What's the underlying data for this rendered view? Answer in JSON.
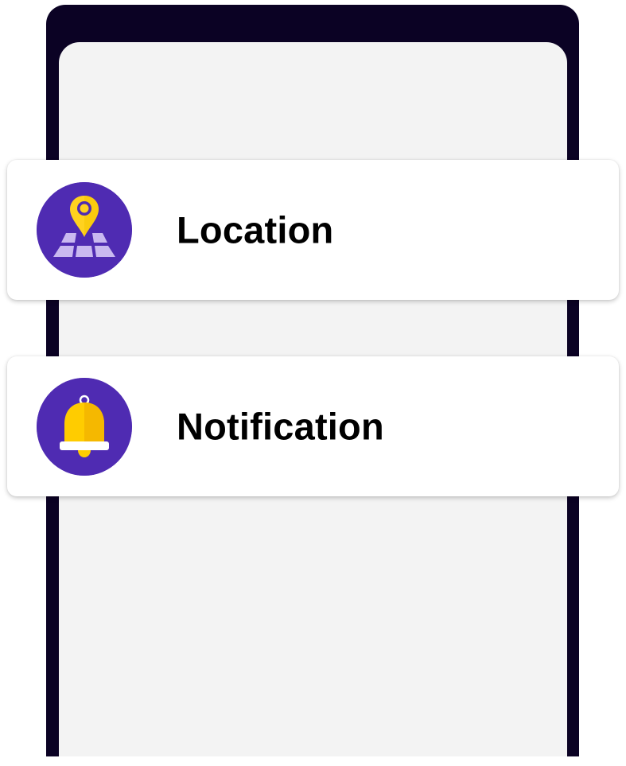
{
  "colors": {
    "phone_frame": "#0b0224",
    "phone_screen": "#f3f3f3",
    "card_background": "#ffffff",
    "icon_circle": "#4f2bb2",
    "pin_yellow": "#ffd21f",
    "map_tiles": "#c9b9f0",
    "bell_yellow": "#ffcc00",
    "bell_shade": "#f5b800"
  },
  "settings": {
    "items": [
      {
        "label": "Location",
        "icon": "location-map-pin-icon"
      },
      {
        "label": "Notification",
        "icon": "bell-icon"
      }
    ]
  }
}
